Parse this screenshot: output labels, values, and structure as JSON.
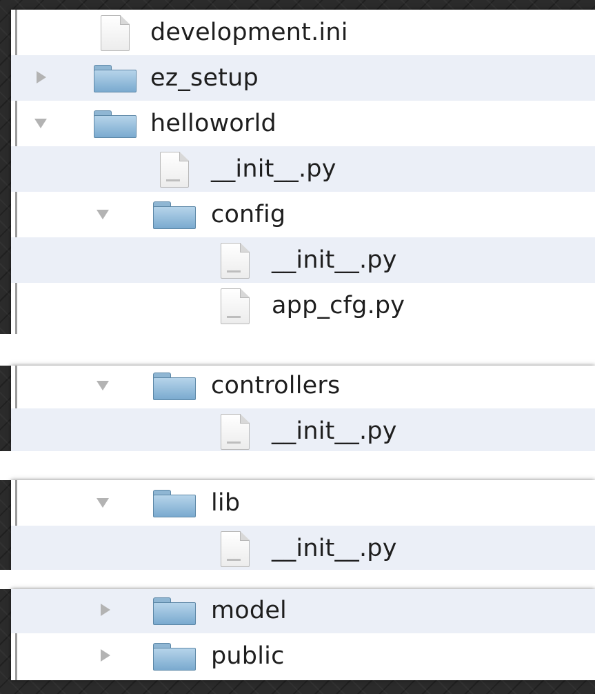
{
  "file_tree": {
    "items": [
      {
        "label": "development.ini",
        "type": "file",
        "depth": 0,
        "state": "none"
      },
      {
        "label": "ez_setup",
        "type": "folder",
        "depth": 0,
        "state": "collapsed"
      },
      {
        "label": "helloworld",
        "type": "folder",
        "depth": 0,
        "state": "expanded"
      },
      {
        "label": "__init__.py",
        "type": "file",
        "depth": 1,
        "state": "none"
      },
      {
        "label": "config",
        "type": "folder",
        "depth": 1,
        "state": "expanded"
      },
      {
        "label": "__init__.py",
        "type": "file",
        "depth": 2,
        "state": "none"
      },
      {
        "label": "app_cfg.py",
        "type": "file",
        "depth": 2,
        "state": "none"
      },
      {
        "label": "controllers",
        "type": "folder",
        "depth": 1,
        "state": "expanded"
      },
      {
        "label": "__init__.py",
        "type": "file",
        "depth": 2,
        "state": "none"
      },
      {
        "label": "lib",
        "type": "folder",
        "depth": 1,
        "state": "expanded"
      },
      {
        "label": "__init__.py",
        "type": "file",
        "depth": 2,
        "state": "none"
      },
      {
        "label": "model",
        "type": "folder",
        "depth": 1,
        "state": "collapsed"
      },
      {
        "label": "public",
        "type": "folder",
        "depth": 1,
        "state": "collapsed"
      }
    ]
  },
  "colors": {
    "row_alternate": "#ebeff7",
    "folder": "#8fb6d3",
    "disclosure": "#b3b3b3",
    "text": "#1e1e1e"
  }
}
